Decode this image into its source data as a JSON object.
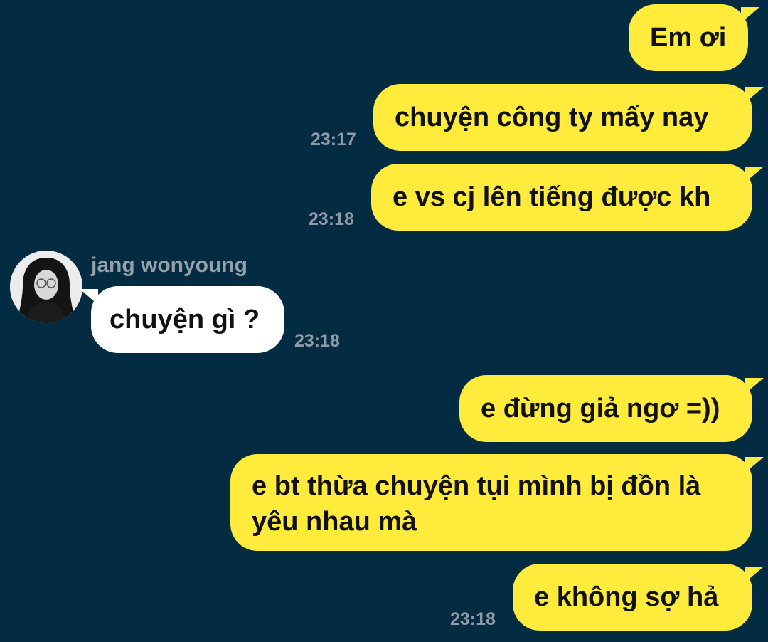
{
  "sender": {
    "name": "jang wonyoung"
  },
  "messages": [
    {
      "text": "Em ơi",
      "time": ""
    },
    {
      "text": "chuyện công ty mấy nay",
      "time": "23:17"
    },
    {
      "text": "e vs cj lên tiếng được kh",
      "time": "23:18"
    },
    {
      "text": "chuyện gì ?",
      "time": "23:18"
    },
    {
      "text": "e đừng giả ngơ =))",
      "time": ""
    },
    {
      "text_line1": "e bt thừa chuyện tụi mình bị đồn là",
      "text_line2": "yêu nhau mà",
      "time": ""
    },
    {
      "text": "e không sợ hả",
      "time": "23:18"
    }
  ],
  "colors": {
    "background": "#032b42",
    "sent_bubble": "#ffeb3b",
    "received_bubble": "#ffffff",
    "timestamp": "#8f9aa4"
  }
}
